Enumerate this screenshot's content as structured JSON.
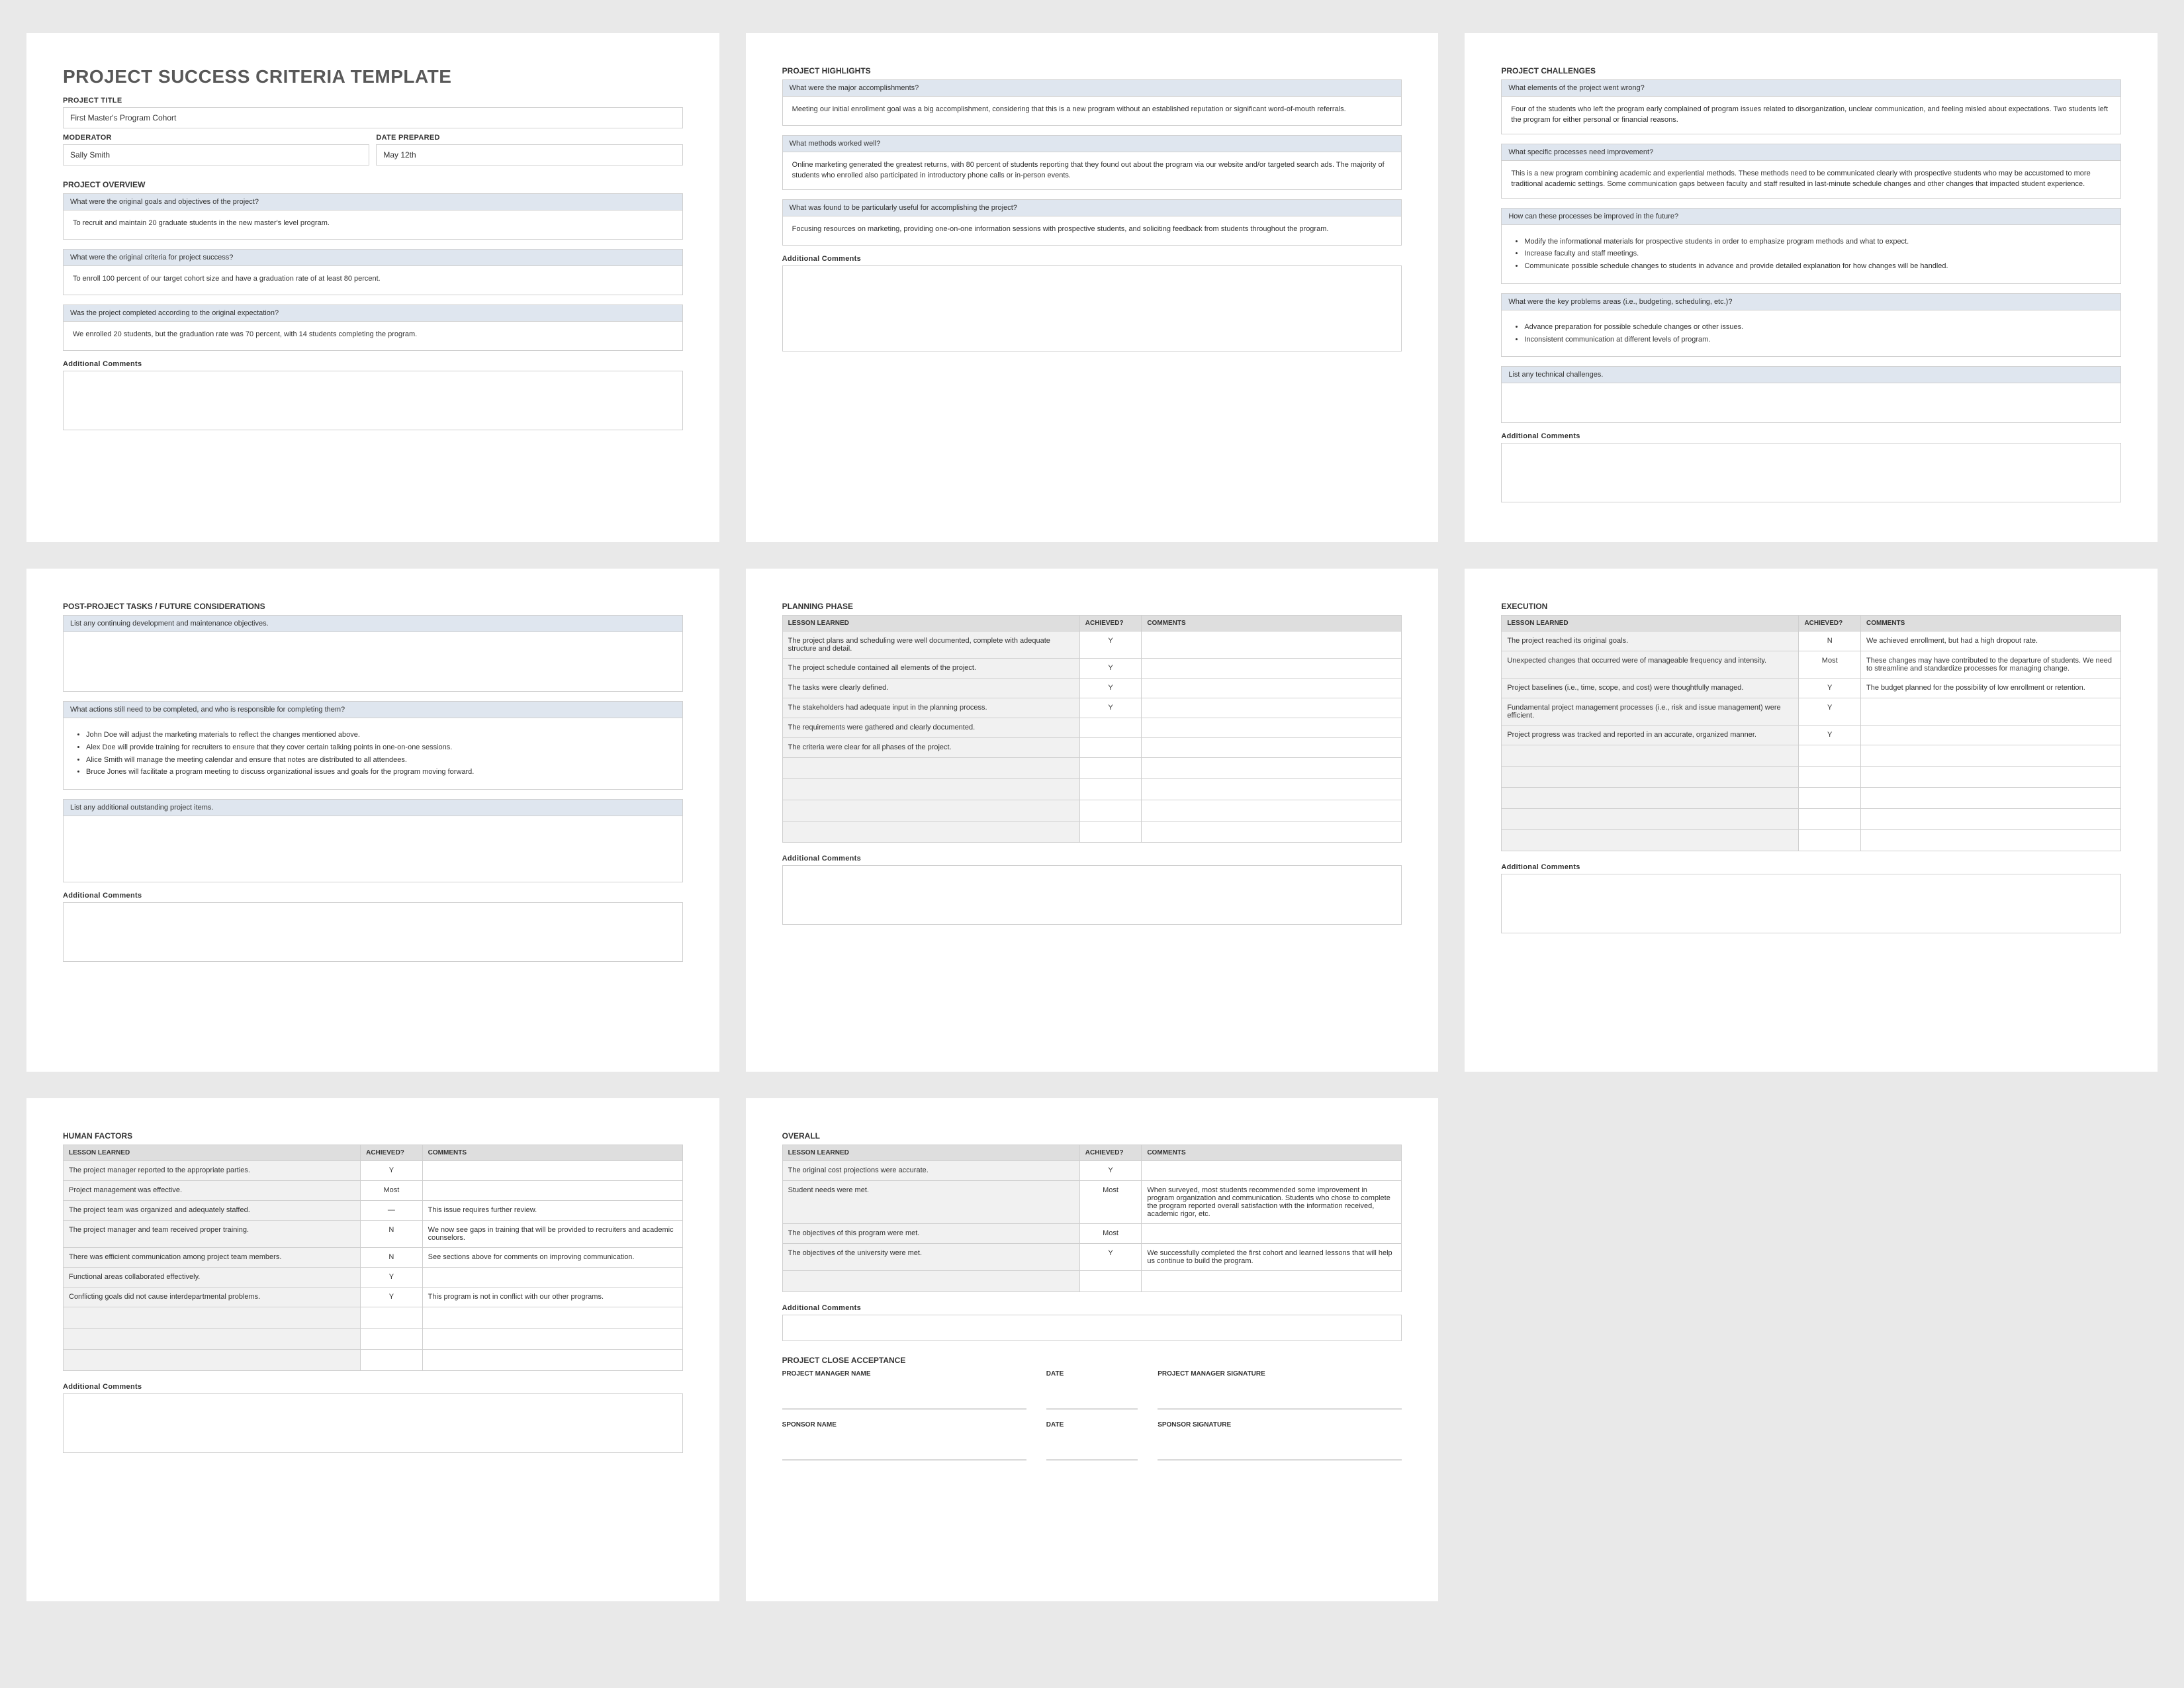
{
  "title": "PROJECT SUCCESS CRITERIA TEMPLATE",
  "labels": {
    "projectTitle": "PROJECT TITLE",
    "moderator": "MODERATOR",
    "datePrepared": "DATE PREPARED",
    "additionalComments": "Additional Comments",
    "lessonLearned": "LESSON LEARNED",
    "achieved": "ACHIEVED?",
    "comments": "COMMENTS",
    "projectCloseAcceptance": "PROJECT CLOSE ACCEPTANCE",
    "pmName": "PROJECT MANAGER NAME",
    "pmSig": "PROJECT MANAGER SIGNATURE",
    "spName": "SPONSOR NAME",
    "spSig": "SPONSOR SIGNATURE",
    "date": "DATE"
  },
  "header": {
    "projectTitle": "First Master's Program Cohort",
    "moderator": "Sally Smith",
    "datePrepared": "May 12th"
  },
  "overview": {
    "heading": "PROJECT OVERVIEW",
    "q1": "What were the original goals and objectives of the project?",
    "a1": "To recruit and maintain 20 graduate students in the new master's level program.",
    "q2": "What were the original criteria for project success?",
    "a2": "To enroll 100 percent of our target cohort size and have a graduation rate of at least 80 percent.",
    "q3": "Was the project completed according to the original expectation?",
    "a3": "We enrolled 20 students, but the graduation rate was 70 percent, with 14 students completing the program."
  },
  "highlights": {
    "heading": "PROJECT HIGHLIGHTS",
    "q1": "What were the major accomplishments?",
    "a1": "Meeting our initial enrollment goal was a big accomplishment, considering that this is a new program without an established reputation or significant word-of-mouth referrals.",
    "q2": "What methods worked well?",
    "a2": "Online marketing generated the greatest returns, with 80 percent of students reporting that they found out about the program via our website and/or targeted search ads. The majority of students who enrolled also participated in introductory phone calls or in-person events.",
    "q3": "What was found to be particularly useful for accomplishing the project?",
    "a3": "Focusing resources on marketing, providing one-on-one information sessions with prospective students, and soliciting feedback from students throughout the program."
  },
  "challenges": {
    "heading": "PROJECT CHALLENGES",
    "q1": "What elements of the project went wrong?",
    "a1": "Four of the students who left the program early complained of program issues related to disorganization, unclear communication, and feeling misled about expectations. Two students left the program for either personal or financial reasons.",
    "q2": "What specific processes need improvement?",
    "a2": "This is a new program combining academic and experiential methods. These methods need to be communicated clearly with prospective students who may be accustomed to more traditional academic settings. Some communication gaps between faculty and staff resulted in last-minute schedule changes and other changes that impacted student experience.",
    "q3": "How can these processes be improved in the future?",
    "a3": [
      "Modify the informational materials for prospective students in order to emphasize program methods and what to expect.",
      "Increase faculty and staff meetings.",
      "Communicate possible schedule changes to students in advance and provide detailed explanation for how changes will be handled."
    ],
    "q4": "What were the key problems areas (i.e., budgeting, scheduling, etc.)?",
    "a4": [
      "Advance preparation for possible schedule changes or other issues.",
      "Inconsistent communication at different levels of program."
    ],
    "q5": "List any technical challenges."
  },
  "postProject": {
    "heading": "POST-PROJECT TASKS / FUTURE CONSIDERATIONS",
    "q1": "List any continuing development and maintenance objectives.",
    "q2": "What actions still need to be completed, and who is responsible for completing them?",
    "a2": [
      "John Doe will adjust the marketing materials to reflect the changes mentioned above.",
      "Alex Doe will provide training for recruiters to ensure that they cover certain talking points in one-on-one sessions.",
      "Alice Smith will manage the meeting calendar and ensure that notes are distributed to all attendees.",
      "Bruce Jones will facilitate a program meeting to discuss organizational issues and goals for the program moving forward."
    ],
    "q3": "List any additional outstanding project items."
  },
  "planning": {
    "heading": "PLANNING PHASE",
    "rows": [
      {
        "l": "The project plans and scheduling were well documented, complete with adequate structure and detail.",
        "a": "Y",
        "c": ""
      },
      {
        "l": "The project schedule contained all elements of the project.",
        "a": "Y",
        "c": ""
      },
      {
        "l": "The tasks were clearly defined.",
        "a": "Y",
        "c": ""
      },
      {
        "l": "The stakeholders had adequate input in the planning process.",
        "a": "Y",
        "c": ""
      },
      {
        "l": "The requirements were gathered and clearly documented.",
        "a": "",
        "c": ""
      },
      {
        "l": "The criteria were clear for all phases of the project.",
        "a": "",
        "c": ""
      }
    ]
  },
  "execution": {
    "heading": "EXECUTION",
    "rows": [
      {
        "l": "The project reached its original goals.",
        "a": "N",
        "c": "We achieved enrollment, but had a high dropout rate."
      },
      {
        "l": "Unexpected changes that occurred were of manageable frequency and intensity.",
        "a": "Most",
        "c": "These changes may have contributed to the departure of students. We need to streamline and standardize processes for managing change."
      },
      {
        "l": "Project baselines (i.e., time, scope, and cost) were thoughtfully managed.",
        "a": "Y",
        "c": "The budget planned for the possibility of low enrollment or retention."
      },
      {
        "l": "Fundamental project management processes (i.e., risk and issue management) were efficient.",
        "a": "Y",
        "c": ""
      },
      {
        "l": "Project progress was tracked and reported in an accurate, organized manner.",
        "a": "Y",
        "c": ""
      }
    ]
  },
  "human": {
    "heading": "HUMAN FACTORS",
    "rows": [
      {
        "l": "The project manager reported to the appropriate parties.",
        "a": "Y",
        "c": ""
      },
      {
        "l": "Project management was effective.",
        "a": "Most",
        "c": ""
      },
      {
        "l": "The project team was organized and adequately staffed.",
        "a": "—",
        "c": "This issue requires further review."
      },
      {
        "l": "The project manager and team received proper training.",
        "a": "N",
        "c": "We now see gaps in training that will be provided to recruiters and academic counselors."
      },
      {
        "l": "There was efficient communication among project team members.",
        "a": "N",
        "c": "See sections above for comments on improving communication."
      },
      {
        "l": "Functional areas collaborated effectively.",
        "a": "Y",
        "c": ""
      },
      {
        "l": "Conflicting goals did not cause interdepartmental problems.",
        "a": "Y",
        "c": "This program is not in conflict with our other programs."
      }
    ]
  },
  "overall": {
    "heading": "OVERALL",
    "rows": [
      {
        "l": "The original cost projections were accurate.",
        "a": "Y",
        "c": ""
      },
      {
        "l": "Student needs were met.",
        "a": "Most",
        "c": "When surveyed, most students recommended some improvement in program organization and communication. Students who chose to complete the program reported overall satisfaction with the information received, academic rigor, etc."
      },
      {
        "l": "The objectives of this program were met.",
        "a": "Most",
        "c": ""
      },
      {
        "l": "The objectives of the university were met.",
        "a": "Y",
        "c": "We successfully completed the first cohort and learned lessons that will help us continue to build the program."
      }
    ]
  }
}
